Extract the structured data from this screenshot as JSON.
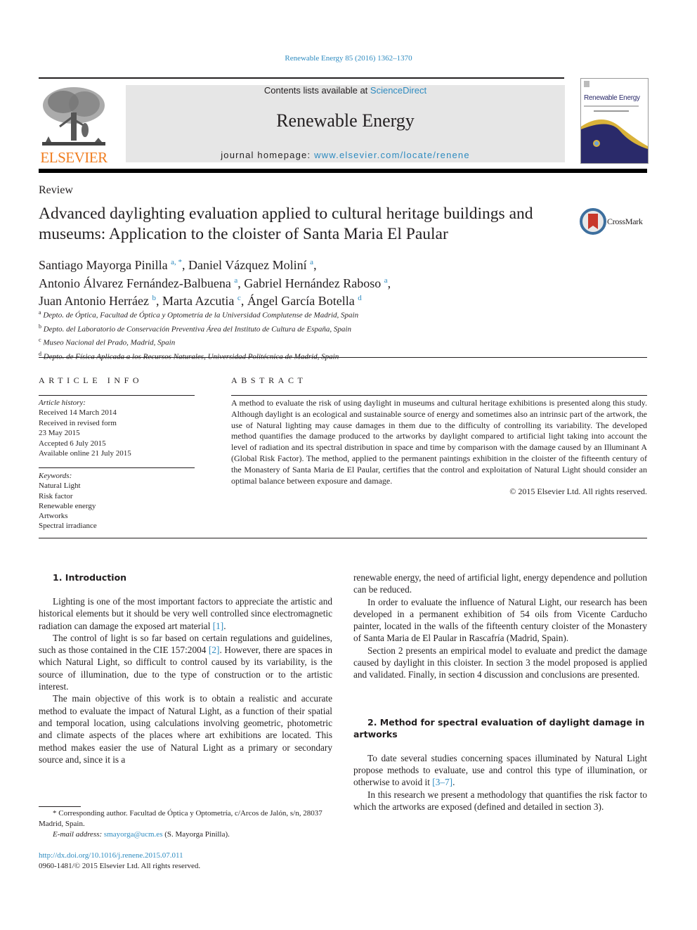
{
  "header": {
    "citation": "Renewable Energy 85 (2016) 1362–1370",
    "contents_prefix": "Contents lists available at ",
    "contents_link": "ScienceDirect",
    "journal_title": "Renewable Energy",
    "homepage_prefix": "journal homepage: ",
    "homepage_link": "www.elsevier.com/locate/renene",
    "publisher_logo_text": "ELSEVIER",
    "cover_title": "Renewable Energy",
    "crossmark_label": "CrossMark"
  },
  "colors": {
    "link": "#2e8bc0",
    "elsevier_orange": "#f07d1f",
    "masthead_bg": "#e6e6e6",
    "cover_navy": "#2a2a6a",
    "cover_gold": "#d9b23a",
    "crossmark_red": "#c8382a"
  },
  "article": {
    "type": "Review",
    "title": "Advanced daylighting evaluation applied to cultural heritage buildings and museums: Application to the cloister of Santa Maria El Paular",
    "authors": [
      {
        "name": "Santiago Mayorga Pinilla",
        "aff": "a, *",
        "sep": ", "
      },
      {
        "name": "Daniel Vázquez Moliní",
        "aff": "a",
        "sep": ","
      },
      {
        "name": "Antonio Álvarez Fernández-Balbuena",
        "aff": "a",
        "sep": ", "
      },
      {
        "name": "Gabriel Hernández Raboso",
        "aff": "a",
        "sep": ","
      },
      {
        "name": "Juan Antonio Herráez",
        "aff": "b",
        "sep": ", "
      },
      {
        "name": "Marta Azcutia",
        "aff": "c",
        "sep": ", "
      },
      {
        "name": "Ángel García Botella",
        "aff": "d",
        "sep": ""
      }
    ],
    "affiliations": [
      {
        "key": "a",
        "text": "Depto. de Óptica, Facultad de Óptica y Optometría de la Universidad Complutense de Madrid, Spain"
      },
      {
        "key": "b",
        "text": "Depto. del Laboratorio de Conservación Preventiva Área del Instituto de Cultura de España, Spain"
      },
      {
        "key": "c",
        "text": "Museo Nacional del Prado, Madrid, Spain"
      },
      {
        "key": "d",
        "text": "Depto. de Física Aplicada a los Recursos Naturales, Universidad Politécnica de Madrid, Spain"
      }
    ]
  },
  "article_info": {
    "heading": "ARTICLE INFO",
    "history_label": "Article history:",
    "history": [
      "Received 14 March 2014",
      "Received in revised form",
      "23 May 2015",
      "Accepted 6 July 2015",
      "Available online 21 July 2015"
    ],
    "keywords_label": "Keywords:",
    "keywords": [
      "Natural Light",
      "Risk factor",
      "Renewable energy",
      "Artworks",
      "Spectral irradiance"
    ]
  },
  "abstract": {
    "heading": "ABSTRACT",
    "text": "A method to evaluate the risk of using daylight in museums and cultural heritage exhibitions is presented along this study. Although daylight is an ecological and sustainable source of energy and sometimes also an intrinsic part of the artwork, the use of Natural lighting may cause damages in them due to the difficulty of controlling its variability. The developed method quantifies the damage produced to the artworks by daylight compared to artificial light taking into account the level of radiation and its spectral distribution in space and time by comparison with the damage caused by an Illuminant A (Global Risk Factor). The method, applied to the permanent paintings exhibition in the cloister of the fifteenth century of the Monastery of Santa Maria de El Paular, certifies that the control and exploitation of Natural Light should consider an optimal balance between exposure and damage.",
    "copyright": "© 2015 Elsevier Ltd. All rights reserved."
  },
  "body": {
    "sec1_heading": "1.  Introduction",
    "p1_text": "Lighting is one of the most important factors to appreciate the artistic and historical elements but it should be very well controlled since electromagnetic radiation can damage the exposed art material ",
    "p1_ref": "[1]",
    "p1_end": ".",
    "p2_text": "The control of light is so far based on certain regulations and guidelines, such as those contained in the CIE 157:2004 ",
    "p2_ref": "[2]",
    "p2_end": ". However, there are spaces in which Natural Light, so difficult to control caused by its variability, is the source of illumination, due to the type of construction or to the artistic interest.",
    "p3_text": "The main objective of this work is to obtain a realistic and accurate method to evaluate the impact of Natural Light, as a function of their spatial and temporal location, using calculations involving geometric, photometric and climate aspects of the places where art exhibitions are located. This method makes easier the use of Natural Light as a primary or secondary source and, since it is a",
    "p3_cont": "renewable energy, the need of artificial light, energy dependence and pollution can be reduced.",
    "p4_text": "In order to evaluate the influence of Natural Light, our research has been developed in a permanent exhibition of 54 oils from Vicente Carducho painter, located in the walls of the fifteenth century cloister of the Monastery of Santa Maria de El Paular in Rascafría (Madrid, Spain).",
    "p5_text": "Section 2 presents an empirical model to evaluate and predict the damage caused by daylight in this cloister. In section 3 the model proposed is applied and validated. Finally, in section 4 discussion and conclusions are presented.",
    "sec2_heading": "2.  Method for spectral evaluation of daylight damage in artworks",
    "p6_text": "To date several studies concerning spaces illuminated by Natural Light propose methods to evaluate, use and control this type of illumination, or otherwise to avoid it ",
    "p6_ref": "[3–7]",
    "p6_end": ".",
    "p7_text": "In this research we present a methodology that quantifies the risk factor to which the artworks are exposed (defined and detailed in section 3)."
  },
  "footnotes": {
    "corresponding": "* Corresponding author. Facultad de Óptica y Optometría, c/Arcos de Jalón, s/n, 28037 Madrid, Spain.",
    "email_label": "E-mail address: ",
    "email": "smayorga@ucm.es",
    "email_suffix": " (S. Mayorga Pinilla).",
    "doi": "http://dx.doi.org/10.1016/j.renene.2015.07.011",
    "issn": "0960-1481/© 2015 Elsevier Ltd. All rights reserved."
  }
}
